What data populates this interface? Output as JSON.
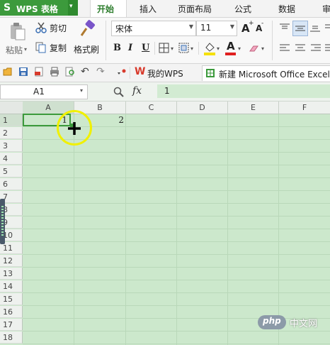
{
  "app": {
    "logo": "S",
    "title": "WPS 表格",
    "menu_arrow": "▾"
  },
  "tabs": [
    {
      "label": "开始"
    },
    {
      "label": "插入"
    },
    {
      "label": "页面布局"
    },
    {
      "label": "公式"
    },
    {
      "label": "数据"
    },
    {
      "label": "审"
    }
  ],
  "ribbon": {
    "paste_label": "粘贴",
    "cut_label": "剪切",
    "copy_label": "复制",
    "format_painter_label": "格式刷",
    "font_name": "宋体",
    "font_size": "11",
    "bold": "B",
    "italic": "I",
    "underline": "U",
    "font_color_letter": "A",
    "grow_font": "A",
    "shrink_font": "A"
  },
  "quick_access": {
    "wps_tab_label": "我的WPS",
    "doc_tab_label": "新建 Microsoft Office Excel"
  },
  "formula_bar": {
    "cell_ref": "A1",
    "fx_label": "fx",
    "value": "1"
  },
  "columns": [
    "A",
    "B",
    "C",
    "D",
    "E",
    "F"
  ],
  "rows": [
    "1",
    "2",
    "3",
    "4",
    "5",
    "6",
    "7",
    "8",
    "9",
    "10",
    "11",
    "12",
    "13",
    "14",
    "15",
    "16",
    "17",
    "18"
  ],
  "cells": {
    "A1": "1",
    "B1": "2"
  },
  "watermark": {
    "text": "中文网"
  },
  "colors": {
    "brand": "#3c9a3c",
    "grid_bg": "#cce8cc",
    "highlight_circle": "#f0f000",
    "font_color_bar": "#e02020",
    "fill_color_bar": "#f5e000"
  }
}
